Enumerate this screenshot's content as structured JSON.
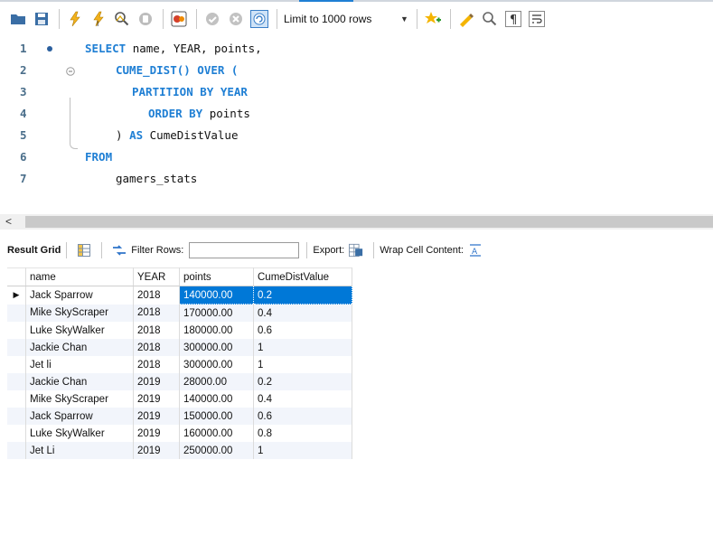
{
  "toolbar": {
    "icons": [
      "open-folder-icon",
      "save-icon",
      "execute-icon",
      "execute-current-icon",
      "explain-icon",
      "stop-icon",
      "toggle-output-icon",
      "commit-icon",
      "rollback-icon",
      "autocommit-icon",
      "bookmark-icon",
      "beautify-icon",
      "find-icon",
      "invisible-chars-icon",
      "wrap-icon"
    ],
    "limit_label": "Limit to 1000 rows"
  },
  "editor": {
    "lines": [
      {
        "n": "1",
        "tokens": [
          {
            "t": "SELECT ",
            "k": "kw"
          },
          {
            "t": "name, YEAR, points,",
            "k": "id"
          }
        ]
      },
      {
        "n": "2",
        "tokens": [
          {
            "t": "CUME_DIST() OVER (",
            "k": "kw"
          }
        ]
      },
      {
        "n": "3",
        "tokens": [
          {
            "t": "PARTITION BY YEAR",
            "k": "kw"
          }
        ]
      },
      {
        "n": "4",
        "tokens": [
          {
            "t": "ORDER BY ",
            "k": "kw"
          },
          {
            "t": "points",
            "k": "id"
          }
        ]
      },
      {
        "n": "5",
        "tokens": [
          {
            "t": ") ",
            "k": "id"
          },
          {
            "t": "AS ",
            "k": "kw"
          },
          {
            "t": "CumeDistValue",
            "k": "id"
          }
        ]
      },
      {
        "n": "6",
        "tokens": [
          {
            "t": "FROM",
            "k": "kw"
          }
        ]
      },
      {
        "n": "7",
        "tokens": [
          {
            "t": "gamers_stats",
            "k": "id"
          }
        ]
      }
    ]
  },
  "results": {
    "result_grid_label": "Result Grid",
    "filter_label": "Filter Rows:",
    "filter_value": "",
    "export_label": "Export:",
    "wrap_label": "Wrap Cell Content:",
    "columns": [
      "name",
      "YEAR",
      "points",
      "CumeDistValue"
    ],
    "rows": [
      [
        "Jack Sparrow",
        "2018",
        "140000.00",
        "0.2"
      ],
      [
        "Mike SkyScraper",
        "2018",
        "170000.00",
        "0.4"
      ],
      [
        "Luke SkyWalker",
        "2018",
        "180000.00",
        "0.6"
      ],
      [
        "Jackie Chan",
        "2018",
        "300000.00",
        "1"
      ],
      [
        "Jet li",
        "2018",
        "300000.00",
        "1"
      ],
      [
        "Jackie Chan",
        "2019",
        "28000.00",
        "0.2"
      ],
      [
        "Mike SkyScraper",
        "2019",
        "140000.00",
        "0.4"
      ],
      [
        "Jack Sparrow",
        "2019",
        "150000.00",
        "0.6"
      ],
      [
        "Luke SkyWalker",
        "2019",
        "160000.00",
        "0.8"
      ],
      [
        "Jet Li",
        "2019",
        "250000.00",
        "1"
      ]
    ]
  }
}
